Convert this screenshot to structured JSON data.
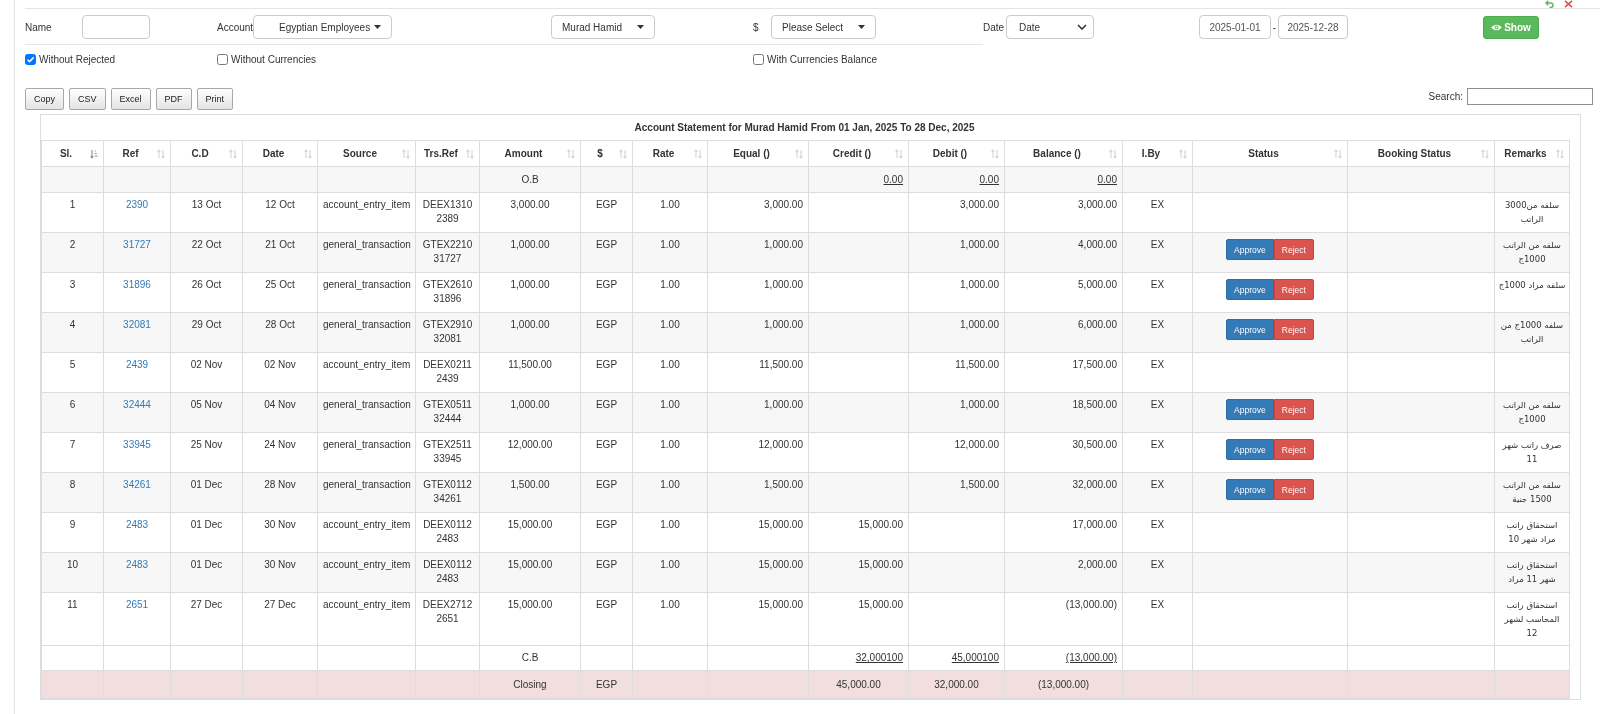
{
  "filters": {
    "name_label": "Name",
    "account_label": "Account",
    "account": "Egyptian Employees",
    "employee": "Murad Hamid",
    "currency_label": "$",
    "currency": "Please Select",
    "date_label": "Date",
    "date_type": "Date",
    "date_from": "2025-01-01",
    "range_separator": "-",
    "date_to": "2025-12-28",
    "show_button": "Show"
  },
  "options": [
    {
      "label": "Without Rejected",
      "checked": true
    },
    {
      "label": "Without Currencies",
      "checked": false
    },
    {
      "label": "With Currencies Balance",
      "checked": false
    }
  ],
  "export_buttons": [
    "Copy",
    "CSV",
    "Excel",
    "PDF",
    "Print"
  ],
  "search": {
    "label": "Search:"
  },
  "table": {
    "caption": "Account Statement for Murad Hamid From 01 Jan, 2025 To 28 Dec, 2025",
    "columns": [
      {
        "label": "Sl.",
        "sorted": true
      },
      {
        "label": "Ref",
        "sorted": false
      },
      {
        "label": "C.D",
        "sorted": false
      },
      {
        "label": "Date",
        "sorted": false
      },
      {
        "label": "Source",
        "sorted": false
      },
      {
        "label": "Trs.Ref",
        "sorted": false
      },
      {
        "label": "Amount",
        "sorted": false
      },
      {
        "label": "$",
        "sorted": false
      },
      {
        "label": "Rate",
        "sorted": false
      },
      {
        "label": "Equal ()",
        "sorted": false
      },
      {
        "label": "Credit ()",
        "sorted": false
      },
      {
        "label": "Debit ()",
        "sorted": false
      },
      {
        "label": "Balance ()",
        "sorted": false
      },
      {
        "label": "I.By",
        "sorted": false
      },
      {
        "label": "Status",
        "sorted": false
      },
      {
        "label": "Booking Status",
        "sorted": false
      },
      {
        "label": "Remarks",
        "sorted": false
      }
    ],
    "rows": [
      {
        "kind": "opening",
        "amount": "O.B",
        "credit": "0.00",
        "debit": "0.00",
        "balance": "0.00"
      },
      {
        "kind": "entry",
        "sl": "1",
        "ref": "2390",
        "cd": "13 Oct",
        "date": "12 Oct",
        "source": "account_entry_item",
        "trs_ref": "DEEX13102389",
        "amount": "3,000.00",
        "currency": "EGP",
        "rate": "1.00",
        "equal": "3,000.00",
        "debit": "3,000.00",
        "balance": "3,000.00",
        "issued_by": "EX",
        "remarks": "سلفه من3000 الراتب"
      },
      {
        "kind": "entry",
        "sl": "2",
        "ref": "31727",
        "cd": "22 Oct",
        "date": "21 Oct",
        "source": "general_transaction",
        "trs_ref": "GTEX221031727",
        "amount": "1,000.00",
        "currency": "EGP",
        "rate": "1.00",
        "equal": "1,000.00",
        "debit": "1,000.00",
        "balance": "4,000.00",
        "issued_by": "EX",
        "actions": [
          {
            "label": "Approve",
            "kind": "approve"
          },
          {
            "label": "Reject",
            "kind": "reject"
          }
        ],
        "remarks": "سلفه من الراتب 1000ج"
      },
      {
        "kind": "entry",
        "sl": "3",
        "ref": "31896",
        "cd": "26 Oct",
        "date": "25 Oct",
        "source": "general_transaction",
        "trs_ref": "GTEX261031896",
        "amount": "1,000.00",
        "currency": "EGP",
        "rate": "1.00",
        "equal": "1,000.00",
        "debit": "1,000.00",
        "balance": "5,000.00",
        "issued_by": "EX",
        "actions": [
          {
            "label": "Approve",
            "kind": "approve"
          },
          {
            "label": "Reject",
            "kind": "reject"
          }
        ],
        "remarks": "سلفه مراد 1000ج"
      },
      {
        "kind": "entry",
        "sl": "4",
        "ref": "32081",
        "cd": "29 Oct",
        "date": "28 Oct",
        "source": "general_transaction",
        "trs_ref": "GTEX291032081",
        "amount": "1,000.00",
        "currency": "EGP",
        "rate": "1.00",
        "equal": "1,000.00",
        "debit": "1,000.00",
        "balance": "6,000.00",
        "issued_by": "EX",
        "actions": [
          {
            "label": "Approve",
            "kind": "approve"
          },
          {
            "label": "Reject",
            "kind": "reject"
          }
        ],
        "remarks": "سلفه 1000ج من الراتب"
      },
      {
        "kind": "entry",
        "sl": "5",
        "ref": "2439",
        "cd": "02 Nov",
        "date": "02 Nov",
        "source": "account_entry_item",
        "trs_ref": "DEEX02112439",
        "amount": "11,500.00",
        "currency": "EGP",
        "rate": "1.00",
        "equal": "11,500.00",
        "debit": "11,500.00",
        "balance": "17,500.00",
        "issued_by": "EX"
      },
      {
        "kind": "entry",
        "sl": "6",
        "ref": "32444",
        "cd": "05 Nov",
        "date": "04 Nov",
        "source": "general_transaction",
        "trs_ref": "GTEX051132444",
        "amount": "1,000.00",
        "currency": "EGP",
        "rate": "1.00",
        "equal": "1,000.00",
        "debit": "1,000.00",
        "balance": "18,500.00",
        "issued_by": "EX",
        "actions": [
          {
            "label": "Approve",
            "kind": "approve"
          },
          {
            "label": "Reject",
            "kind": "reject"
          }
        ],
        "remarks": "سلفه من الراتب 1000ج"
      },
      {
        "kind": "entry",
        "sl": "7",
        "ref": "33945",
        "cd": "25 Nov",
        "date": "24 Nov",
        "source": "general_transaction",
        "trs_ref": "GTEX251133945",
        "amount": "12,000.00",
        "currency": "EGP",
        "rate": "1.00",
        "equal": "12,000.00",
        "debit": "12,000.00",
        "balance": "30,500.00",
        "issued_by": "EX",
        "actions": [
          {
            "label": "Approve",
            "kind": "approve"
          },
          {
            "label": "Reject",
            "kind": "reject"
          }
        ],
        "remarks": "صرف راتب شهر 11"
      },
      {
        "kind": "entry",
        "sl": "8",
        "ref": "34261",
        "cd": "01 Dec",
        "date": "28 Nov",
        "source": "general_transaction",
        "trs_ref": "GTEX011234261",
        "amount": "1,500.00",
        "currency": "EGP",
        "rate": "1.00",
        "equal": "1,500.00",
        "debit": "1,500.00",
        "balance": "32,000.00",
        "issued_by": "EX",
        "actions": [
          {
            "label": "Approve",
            "kind": "approve"
          },
          {
            "label": "Reject",
            "kind": "reject"
          }
        ],
        "remarks": "سلفه من الراتب 1500 جنية"
      },
      {
        "kind": "entry",
        "sl": "9",
        "ref": "2483",
        "cd": "01 Dec",
        "date": "30 Nov",
        "source": "account_entry_item",
        "trs_ref": "DEEX01122483",
        "amount": "15,000.00",
        "currency": "EGP",
        "rate": "1.00",
        "equal": "15,000.00",
        "credit": "15,000.00",
        "balance": "17,000.00",
        "issued_by": "EX",
        "remarks": "استحقاق راتب مراد شهر 10"
      },
      {
        "kind": "entry",
        "sl": "10",
        "ref": "2483",
        "cd": "01 Dec",
        "date": "30 Nov",
        "source": "account_entry_item",
        "trs_ref": "DEEX01122483",
        "amount": "15,000.00",
        "currency": "EGP",
        "rate": "1.00",
        "equal": "15,000.00",
        "credit": "15,000.00",
        "balance": "2,000.00",
        "issued_by": "EX",
        "remarks": "استحقاق راتب شهر 11 مراد"
      },
      {
        "kind": "entry",
        "sl": "11",
        "ref": "2651",
        "cd": "27 Dec",
        "date": "27 Dec",
        "source": "account_entry_item",
        "trs_ref": "DEEX27122651",
        "amount": "15,000.00",
        "currency": "EGP",
        "rate": "1.00",
        "equal": "15,000.00",
        "credit": "15,000.00",
        "balance": "(13,000.00)",
        "issued_by": "EX",
        "remarks": "استحقاق راتب المحاسب لشهر 12"
      },
      {
        "kind": "closing_balance",
        "amount": "C.B",
        "credit": "32,000100",
        "debit": "45,000100",
        "balance": "(13,000.00)"
      },
      {
        "kind": "closing",
        "amount": "Closing",
        "currency": "EGP",
        "credit": "45,000.00",
        "debit": "32,000.00",
        "balance": "(13,000.00)"
      }
    ]
  }
}
